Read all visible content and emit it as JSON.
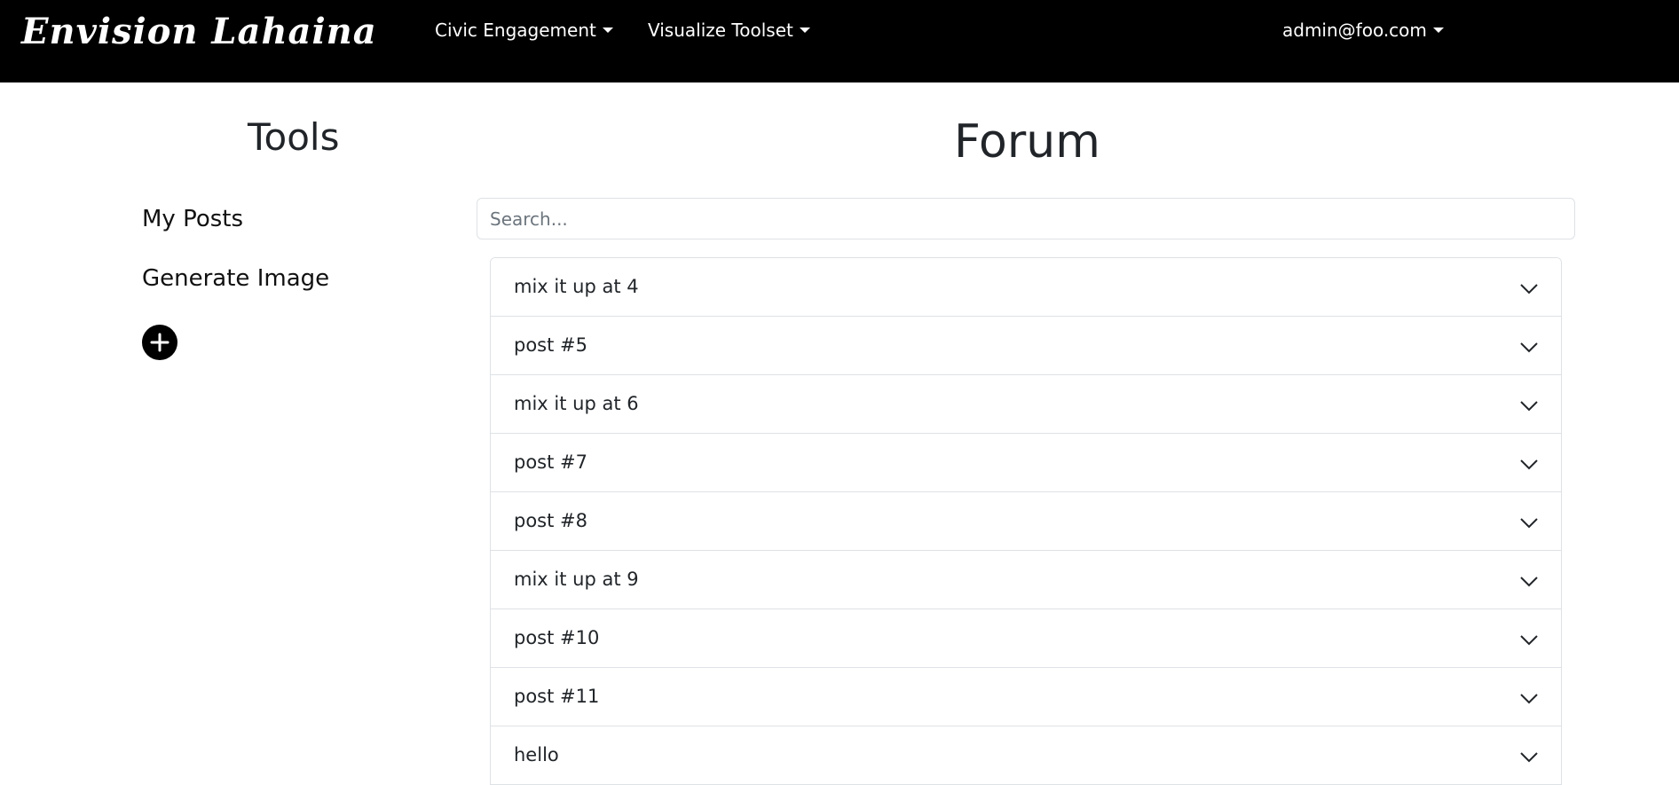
{
  "navbar": {
    "brand": "Envision Lahaina",
    "links": [
      {
        "label": "Civic Engagement"
      },
      {
        "label": "Visualize Toolset"
      }
    ],
    "user": "admin@foo.com"
  },
  "sidebar": {
    "title": "Tools",
    "items": [
      {
        "label": "My Posts"
      },
      {
        "label": "Generate Image"
      }
    ],
    "add_icon": "plus-circle-icon"
  },
  "main": {
    "title": "Forum",
    "search": {
      "placeholder": "Search...",
      "value": ""
    },
    "posts": [
      {
        "title": "mix it up at 4"
      },
      {
        "title": "post #5"
      },
      {
        "title": "mix it up at 6"
      },
      {
        "title": "post #7"
      },
      {
        "title": "post #8"
      },
      {
        "title": "mix it up at 9"
      },
      {
        "title": "post #10"
      },
      {
        "title": "post #11"
      },
      {
        "title": "hello"
      }
    ],
    "expand_icon": "chevron-down-icon"
  },
  "colors": {
    "navbar_bg": "#000000",
    "border": "#dee2e6",
    "text": "#212529"
  }
}
